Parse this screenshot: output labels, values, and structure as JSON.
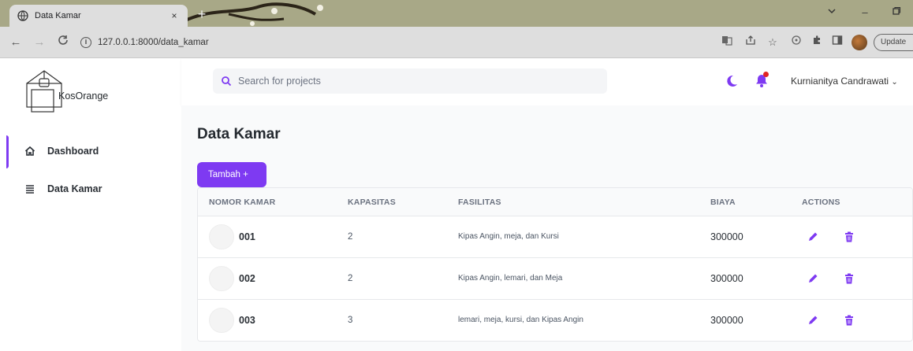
{
  "browser": {
    "tab_title": "Data Kamar",
    "tab_close": "×",
    "new_tab": "+",
    "url": "127.0.0.1:8000/data_kamar",
    "update_label": "Update",
    "window": {
      "minimize": "–",
      "restore": "ˇ",
      "maximize": "❐"
    }
  },
  "app": {
    "brand": "KosOrange",
    "accent_color": "#7e3af2"
  },
  "sidebar": {
    "items": [
      {
        "label": "Dashboard",
        "icon": "home-icon",
        "active": true
      },
      {
        "label": "Data Kamar",
        "icon": "list-icon",
        "active": false
      }
    ]
  },
  "header": {
    "search_placeholder": "Search for projects",
    "user_name": "Kurnianitya Candrawati"
  },
  "main": {
    "title": "Data Kamar",
    "add_button": "Tambah +",
    "columns": [
      "NOMOR KAMAR",
      "KAPASITAS",
      "FASILITAS",
      "BIAYA",
      "ACTIONS"
    ],
    "rows": [
      {
        "nomor": "001",
        "kapasitas": "2",
        "fasilitas": "Kipas Angin, meja, dan Kursi",
        "biaya": "300000"
      },
      {
        "nomor": "002",
        "kapasitas": "2",
        "fasilitas": "Kipas Angin, lemari, dan Meja",
        "biaya": "300000"
      },
      {
        "nomor": "003",
        "kapasitas": "3",
        "fasilitas": "lemari, meja, kursi, dan Kipas Angin",
        "biaya": "300000"
      }
    ]
  }
}
